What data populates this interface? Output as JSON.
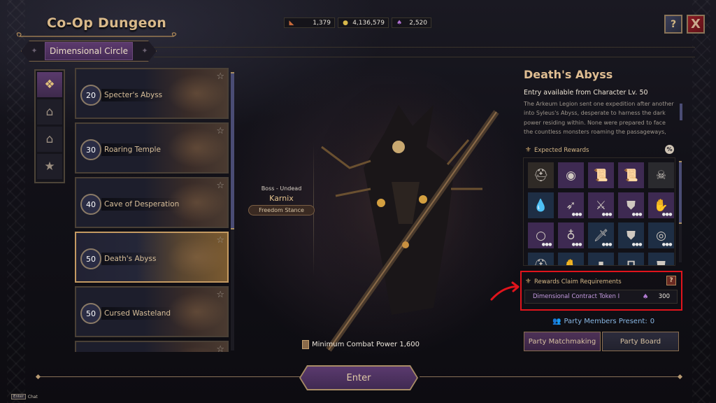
{
  "header": {
    "title": "Co-Op Dungeon",
    "subtab": "Dimensional Circle"
  },
  "currencies": [
    {
      "icon": "ticket-icon",
      "glyph": "◣",
      "color": "#c86a3a",
      "value": "1,379"
    },
    {
      "icon": "gold-coin-icon",
      "glyph": "●",
      "color": "#d8b84a",
      "value": "4,136,579"
    },
    {
      "icon": "dimensional-token-icon",
      "glyph": "♠",
      "color": "#b070d0",
      "value": "2,520"
    }
  ],
  "top_buttons": {
    "help": "?",
    "close": "X"
  },
  "category_tabs": [
    {
      "name": "all-dungeons",
      "glyph": "❖",
      "active": true
    },
    {
      "name": "gate",
      "glyph": "⌂",
      "active": false
    },
    {
      "name": "gate-special",
      "glyph": "⌂",
      "active": false
    },
    {
      "name": "favorites",
      "glyph": "★",
      "active": false
    }
  ],
  "dungeons": [
    {
      "level": "20",
      "name": "Specter's Abyss",
      "selected": false
    },
    {
      "level": "30",
      "name": "Roaring Temple",
      "selected": false
    },
    {
      "level": "40",
      "name": "Cave of Desperation",
      "selected": false
    },
    {
      "level": "50",
      "name": "Death's Abyss",
      "selected": true
    },
    {
      "level": "50",
      "name": "Cursed Wasteland",
      "selected": false
    },
    {
      "level": "",
      "name": "",
      "selected": false
    }
  ],
  "boss": {
    "type": "Boss - Undead",
    "name": "Karnix",
    "stance": "Freedom Stance"
  },
  "detail": {
    "title": "Death's Abyss",
    "entry_requirement": "Entry available from Character Lv. 50",
    "description": "The Arkeum Legion sent one expedition after another into Syleus's Abyss, desperate to harness the dark power residing within. None were prepared to face the countless monsters roaming the passageways, nor navigate the",
    "expected_rewards_label": "Expected Rewards",
    "percent_button": "%",
    "rewards": [
      {
        "name": "helmet-lamp",
        "glyph": "⛑",
        "bg": "c-brown",
        "more": false
      },
      {
        "name": "medal",
        "glyph": "◉",
        "bg": "c-purple",
        "more": false
      },
      {
        "name": "scroll-red",
        "glyph": "📜",
        "bg": "c-purple",
        "more": false
      },
      {
        "name": "scroll-gold",
        "glyph": "📜",
        "bg": "c-purple",
        "more": false
      },
      {
        "name": "skull-coin",
        "glyph": "☠",
        "bg": "c-gray",
        "more": false
      },
      {
        "name": "water-drop",
        "glyph": "💧",
        "bg": "c-blue",
        "more": false
      },
      {
        "name": "bow",
        "glyph": "➶",
        "bg": "c-purple",
        "more": true
      },
      {
        "name": "sword-shield",
        "glyph": "⚔",
        "bg": "c-purple",
        "more": true
      },
      {
        "name": "armor",
        "glyph": "⛊",
        "bg": "c-purple",
        "more": true
      },
      {
        "name": "gauntlet",
        "glyph": "✋",
        "bg": "c-purple",
        "more": true
      },
      {
        "name": "ring",
        "glyph": "○",
        "bg": "c-purple",
        "more": true
      },
      {
        "name": "necklace",
        "glyph": "♁",
        "bg": "c-purple",
        "more": true
      },
      {
        "name": "sword",
        "glyph": "🗡",
        "bg": "c-blue",
        "more": true
      },
      {
        "name": "chest-armor",
        "glyph": "⛊",
        "bg": "c-blue",
        "more": true
      },
      {
        "name": "bracelet",
        "glyph": "◎",
        "bg": "c-blue",
        "more": true
      },
      {
        "name": "helm",
        "glyph": "⛑",
        "bg": "c-blue",
        "more": false
      },
      {
        "name": "gloves",
        "glyph": "✋",
        "bg": "c-blue",
        "more": false
      },
      {
        "name": "boots",
        "glyph": "▮",
        "bg": "c-blue",
        "more": false
      },
      {
        "name": "pants",
        "glyph": "∏",
        "bg": "c-blue",
        "more": false
      },
      {
        "name": "plate-armor",
        "glyph": "⛊",
        "bg": "c-blue",
        "more": false
      }
    ],
    "claim": {
      "label": "Rewards Claim Requirements",
      "help": "?",
      "item_name": "Dimensional Contract Token I",
      "item_value": "300"
    },
    "party_present_label": "Party Members Present:",
    "party_present_count": "0",
    "party_matchmaking": "Party Matchmaking",
    "party_board": "Party Board"
  },
  "footer": {
    "min_combat_power": "Minimum Combat Power 1,600",
    "enter": "Enter",
    "chat_key": "Enter",
    "chat_label": "Chat"
  },
  "colors": {
    "accent_gold": "#d9b98a",
    "accent_purple": "#5a3a6e",
    "highlight_red": "#e0141c",
    "party_blue": "#8ab8e4"
  }
}
